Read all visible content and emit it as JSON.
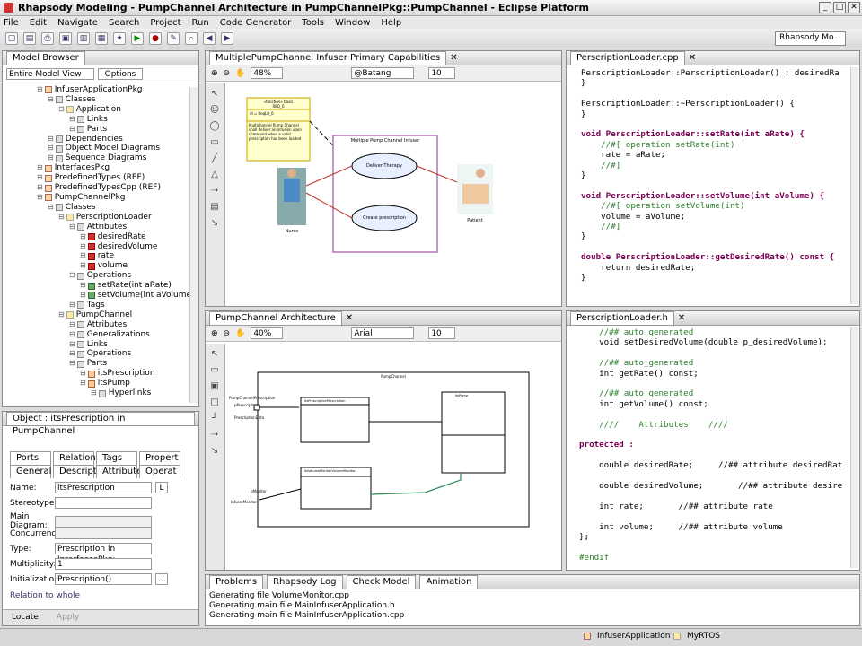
{
  "window": {
    "title": "Rhapsody Modeling - PumpChannel Architecture in PumpChannelPkg::PumpChannel - Eclipse Platform"
  },
  "menu": [
    "File",
    "Edit",
    "Navigate",
    "Search",
    "Project",
    "Run",
    "Code Generator",
    "Tools",
    "Window",
    "Help"
  ],
  "perspective": "Rhapsody Mo...",
  "model_browser": {
    "title": "Model Browser",
    "filter": "Entire Model View",
    "options": "Options",
    "tree": [
      {
        "label": "InfuserApplicationPkg",
        "indent": 3,
        "icon": "pkg"
      },
      {
        "label": "Classes",
        "indent": 4,
        "icon": "fld"
      },
      {
        "label": "Application",
        "indent": 5,
        "icon": "cls"
      },
      {
        "label": "Links",
        "indent": 6,
        "icon": "fld"
      },
      {
        "label": "Parts",
        "indent": 6,
        "icon": "fld"
      },
      {
        "label": "Dependencies",
        "indent": 4,
        "icon": "fld"
      },
      {
        "label": "Object Model Diagrams",
        "indent": 4,
        "icon": "fld"
      },
      {
        "label": "Sequence Diagrams",
        "indent": 4,
        "icon": "fld"
      },
      {
        "label": "InterfacesPkg",
        "indent": 3,
        "icon": "pkg"
      },
      {
        "label": "PredefinedTypes (REF)",
        "indent": 3,
        "icon": "pkg"
      },
      {
        "label": "PredefinedTypesCpp (REF)",
        "indent": 3,
        "icon": "pkg"
      },
      {
        "label": "PumpChannelPkg",
        "indent": 3,
        "icon": "pkg"
      },
      {
        "label": "Classes",
        "indent": 4,
        "icon": "fld"
      },
      {
        "label": "PerscriptionLoader",
        "indent": 5,
        "icon": "cls"
      },
      {
        "label": "Attributes",
        "indent": 6,
        "icon": "fld"
      },
      {
        "label": "desiredRate",
        "indent": 7,
        "icon": "attr"
      },
      {
        "label": "desiredVolume",
        "indent": 7,
        "icon": "attr"
      },
      {
        "label": "rate",
        "indent": 7,
        "icon": "attr"
      },
      {
        "label": "volume",
        "indent": 7,
        "icon": "attr"
      },
      {
        "label": "Operations",
        "indent": 6,
        "icon": "fld"
      },
      {
        "label": "setRate(int aRate)",
        "indent": 7,
        "icon": "op"
      },
      {
        "label": "setVolume(int aVolume)",
        "indent": 7,
        "icon": "op"
      },
      {
        "label": "Tags",
        "indent": 6,
        "icon": "fld"
      },
      {
        "label": "PumpChannel",
        "indent": 5,
        "icon": "cls"
      },
      {
        "label": "Attributes",
        "indent": 6,
        "icon": "fld"
      },
      {
        "label": "Generalizations",
        "indent": 6,
        "icon": "fld"
      },
      {
        "label": "Links",
        "indent": 6,
        "icon": "fld"
      },
      {
        "label": "Operations",
        "indent": 6,
        "icon": "fld"
      },
      {
        "label": "Parts",
        "indent": 6,
        "icon": "fld"
      },
      {
        "label": "itsPrescription",
        "indent": 7,
        "icon": "part"
      },
      {
        "label": "itsPump",
        "indent": 7,
        "icon": "part"
      },
      {
        "label": "Hyperlinks",
        "indent": 8,
        "icon": "fld"
      }
    ]
  },
  "properties": {
    "title": "Object : itsPrescription in PumpChannel",
    "tabs_top": [
      "Ports",
      "Relations",
      "Tags",
      "Propert"
    ],
    "tabs_bottom": [
      "General",
      "Description",
      "Attributes",
      "Operat"
    ],
    "name_label": "Name:",
    "name_value": "itsPrescription",
    "name_btn": "L",
    "stereotype_label": "Stereotype:",
    "main_diagram_label": "Main Diagram:",
    "concurrency_label": "Concurrency:",
    "type_label": "Type:",
    "type_value": "Prescription in InterfacesPkg:",
    "multiplicity_label": "Multiplicity:",
    "multiplicity_value": "1",
    "init_label": "Initialization:",
    "init_value": "Prescription()",
    "init_btn": "...",
    "relation": "Relation to whole",
    "locate": "Locate",
    "apply": "Apply"
  },
  "uc_editor": {
    "tab": "MultiplePumpChannel Infuser Primary Capabilities",
    "zoom": "48%",
    "font": "@Batang",
    "size": "10",
    "note_title": "«function» basis",
    "note_sub": "REQ_6",
    "note_body": "Multichannel Pump Channel shall deliver an infusion upon command when a valid prescription has been loaded",
    "boundary": "Multiple Pump Channel Infuser",
    "uc1": "Deliver Therapy",
    "uc2": "Create prescription",
    "actor1": "Nurse",
    "actor2": "Patient",
    "id_line": "id = ReqLB_6"
  },
  "arch_editor": {
    "tab": "PumpChannel Architecture",
    "zoom": "40%",
    "font": "Arial",
    "size": "10",
    "frame": "PumpChannel",
    "port1": "PumpChannelPrescription",
    "port2": "pPrescription",
    "port3": "PrescriptionData",
    "port4": "pMonitor",
    "port5": "InfuserMonitor",
    "part1": "itsPrescriptionPerscription",
    "part2": "itsPump",
    "part3": "itsVolumeMonitorVolumeMonitor"
  },
  "code1": {
    "tab": "PerscriptionLoader.cpp",
    "lines": [
      {
        "t": "PerscriptionLoader::PerscriptionLoader() : desiredRa",
        "c": ""
      },
      {
        "t": "}",
        "c": ""
      },
      {
        "t": "",
        "c": ""
      },
      {
        "t": "PerscriptionLoader::~PerscriptionLoader() {",
        "c": ""
      },
      {
        "t": "}",
        "c": ""
      },
      {
        "t": "",
        "c": ""
      },
      {
        "t": "void PerscriptionLoader::setRate(int aRate) {",
        "c": "k"
      },
      {
        "t": "    //#[ operation setRate(int)",
        "c": "c"
      },
      {
        "t": "    rate = aRate;",
        "c": ""
      },
      {
        "t": "    //#]",
        "c": "c"
      },
      {
        "t": "}",
        "c": ""
      },
      {
        "t": "",
        "c": ""
      },
      {
        "t": "void PerscriptionLoader::setVolume(int aVolume) {",
        "c": "k"
      },
      {
        "t": "    //#[ operation setVolume(int)",
        "c": "c"
      },
      {
        "t": "    volume = aVolume;",
        "c": ""
      },
      {
        "t": "    //#]",
        "c": "c"
      },
      {
        "t": "}",
        "c": ""
      },
      {
        "t": "",
        "c": ""
      },
      {
        "t": "double PerscriptionLoader::getDesiredRate() const {",
        "c": "k"
      },
      {
        "t": "    return desiredRate;",
        "c": ""
      },
      {
        "t": "}",
        "c": ""
      }
    ]
  },
  "code2": {
    "tab": "PerscriptionLoader.h",
    "lines": [
      {
        "t": "    //## auto_generated",
        "c": "c"
      },
      {
        "t": "    void setDesiredVolume(double p_desiredVolume);",
        "c": ""
      },
      {
        "t": "",
        "c": ""
      },
      {
        "t": "    //## auto_generated",
        "c": "c"
      },
      {
        "t": "    int getRate() const;",
        "c": ""
      },
      {
        "t": "",
        "c": ""
      },
      {
        "t": "    //## auto_generated",
        "c": "c"
      },
      {
        "t": "    int getVolume() const;",
        "c": ""
      },
      {
        "t": "",
        "c": ""
      },
      {
        "t": "    ////    Attributes    ////",
        "c": "c"
      },
      {
        "t": "",
        "c": ""
      },
      {
        "t": "protected :",
        "c": "k"
      },
      {
        "t": "",
        "c": ""
      },
      {
        "t": "    double desiredRate;     //## attribute desiredRat",
        "c": ""
      },
      {
        "t": "",
        "c": ""
      },
      {
        "t": "    double desiredVolume;       //## attribute desire",
        "c": ""
      },
      {
        "t": "",
        "c": ""
      },
      {
        "t": "    int rate;       //## attribute rate",
        "c": ""
      },
      {
        "t": "",
        "c": ""
      },
      {
        "t": "    int volume;     //## attribute volume",
        "c": ""
      },
      {
        "t": "};",
        "c": ""
      },
      {
        "t": "",
        "c": ""
      },
      {
        "t": "#endif",
        "c": "c"
      }
    ]
  },
  "log": {
    "tabs": [
      "Problems",
      "Rhapsody Log",
      "Check Model",
      "Animation"
    ],
    "lines": [
      "Generating file VolumeMonitor.cpp",
      "Generating main file MainInfuserApplication.h",
      "Generating main file MainInfuserApplication.cpp"
    ]
  },
  "status": {
    "app": "InfuserApplication",
    "rtos": "MyRTOS"
  }
}
